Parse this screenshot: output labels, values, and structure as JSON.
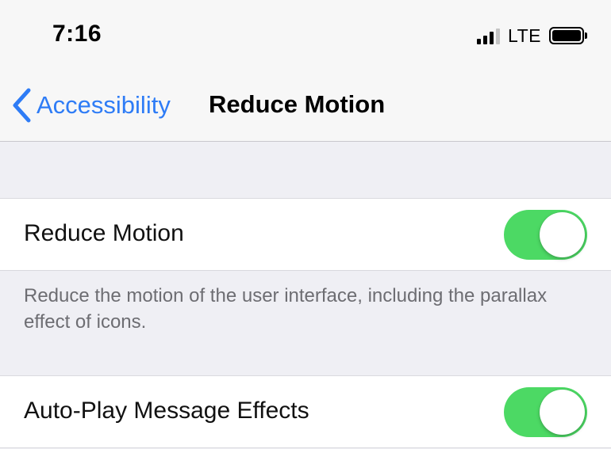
{
  "status_bar": {
    "time": "7:16",
    "network": "LTE",
    "signal_icon": "cellular-signal-icon",
    "battery_icon": "battery-full-icon"
  },
  "nav": {
    "back_label": "Accessibility",
    "back_icon": "chevron-left-icon",
    "title": "Reduce Motion"
  },
  "settings": [
    {
      "label": "Reduce Motion",
      "enabled": true,
      "footer": "Reduce the motion of the user interface, including the parallax effect of icons."
    },
    {
      "label": "Auto-Play Message Effects",
      "enabled": true
    }
  ],
  "colors": {
    "accent": "#2e7cf6",
    "toggle_on": "#4cd964",
    "background": "#efeff4",
    "footnote": "#6d6d72"
  }
}
